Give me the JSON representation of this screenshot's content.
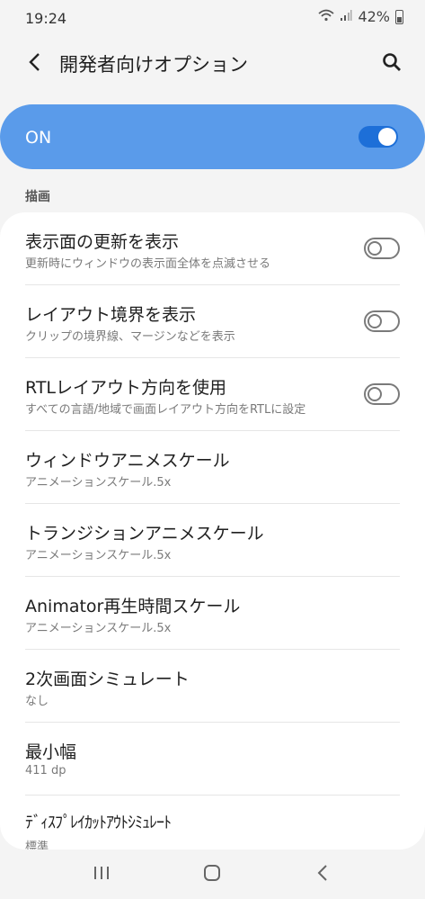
{
  "status_bar": {
    "time": "19:24",
    "battery": "42%"
  },
  "app_bar": {
    "title": "開発者向けオプション"
  },
  "master_switch": {
    "label": "ON",
    "state": "on",
    "accent_color": "#1d6fd8"
  },
  "section": {
    "header": "描画"
  },
  "items": [
    {
      "title": "表示面の更新を表示",
      "subtitle": "更新時にウィンドウの表示面全体を点滅させる",
      "toggle": "off"
    },
    {
      "title": "レイアウト境界を表示",
      "subtitle": "クリップの境界線、マージンなどを表示",
      "toggle": "off"
    },
    {
      "title": "RTLレイアウト方向を使用",
      "subtitle": "すべての言語/地域で画面レイアウト方向をRTLに設定",
      "toggle": "off"
    },
    {
      "title": "ウィンドウアニメスケール",
      "subtitle": "アニメーションスケール.5x"
    },
    {
      "title": "トランジションアニメスケール",
      "subtitle": "アニメーションスケール.5x"
    },
    {
      "title": "Animator再生時間スケール",
      "subtitle": "アニメーションスケール.5x"
    },
    {
      "title": "2次画面シミュレート",
      "subtitle": "なし"
    },
    {
      "title": "最小幅",
      "subtitle": "411 dp"
    },
    {
      "title": "ﾃﾞｨｽﾌﾟﾚｲｶｯﾄｱｳﾄｼﾐｭﾚｰﾄ",
      "subtitle": "標準"
    }
  ],
  "icons": {
    "back": "chevron-left-icon",
    "search": "search-icon",
    "nav_recents": "recents-icon",
    "nav_home": "home-icon",
    "nav_back": "nav-back-icon"
  }
}
